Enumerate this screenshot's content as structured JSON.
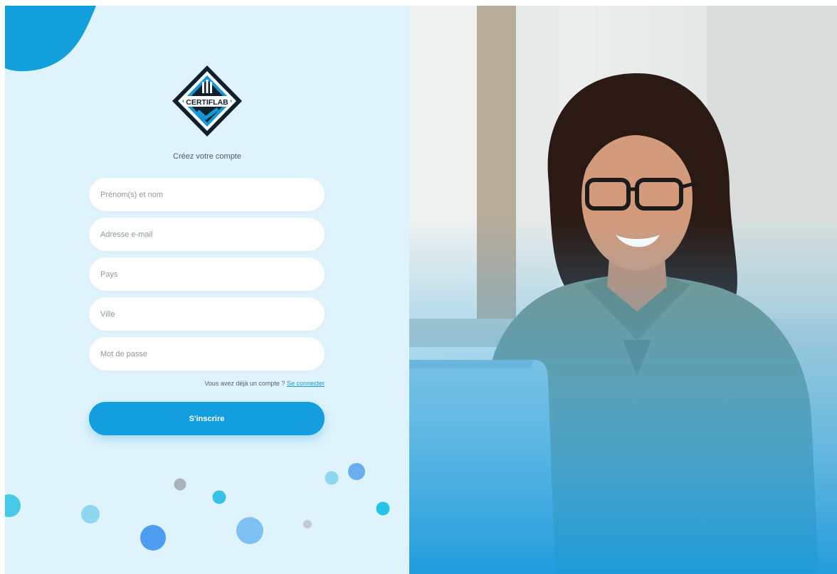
{
  "brand": {
    "logo_text": "CERTIFLAB"
  },
  "form": {
    "subtitle": "Créez votre compte",
    "fields": [
      {
        "name": "fullname",
        "placeholder": "Prénom(s) et nom",
        "value": ""
      },
      {
        "name": "email",
        "placeholder": "Adresse e-mail",
        "value": ""
      },
      {
        "name": "country",
        "placeholder": "Pays",
        "value": ""
      },
      {
        "name": "city",
        "placeholder": "Ville",
        "value": ""
      },
      {
        "name": "password",
        "placeholder": "Mot de passe",
        "value": ""
      }
    ],
    "login_prompt": "Vous avez déjà un compte ?",
    "login_link": "Se connecter",
    "submit_label": "S'inscrire"
  },
  "colors": {
    "panel_bg": "#dff3fc",
    "accent": "#139fdf",
    "logo_dark": "#0f1f2b",
    "logo_blue": "#1597d4"
  },
  "icons": [
    "certiflab-logo-icon",
    "check-mark-icon"
  ]
}
